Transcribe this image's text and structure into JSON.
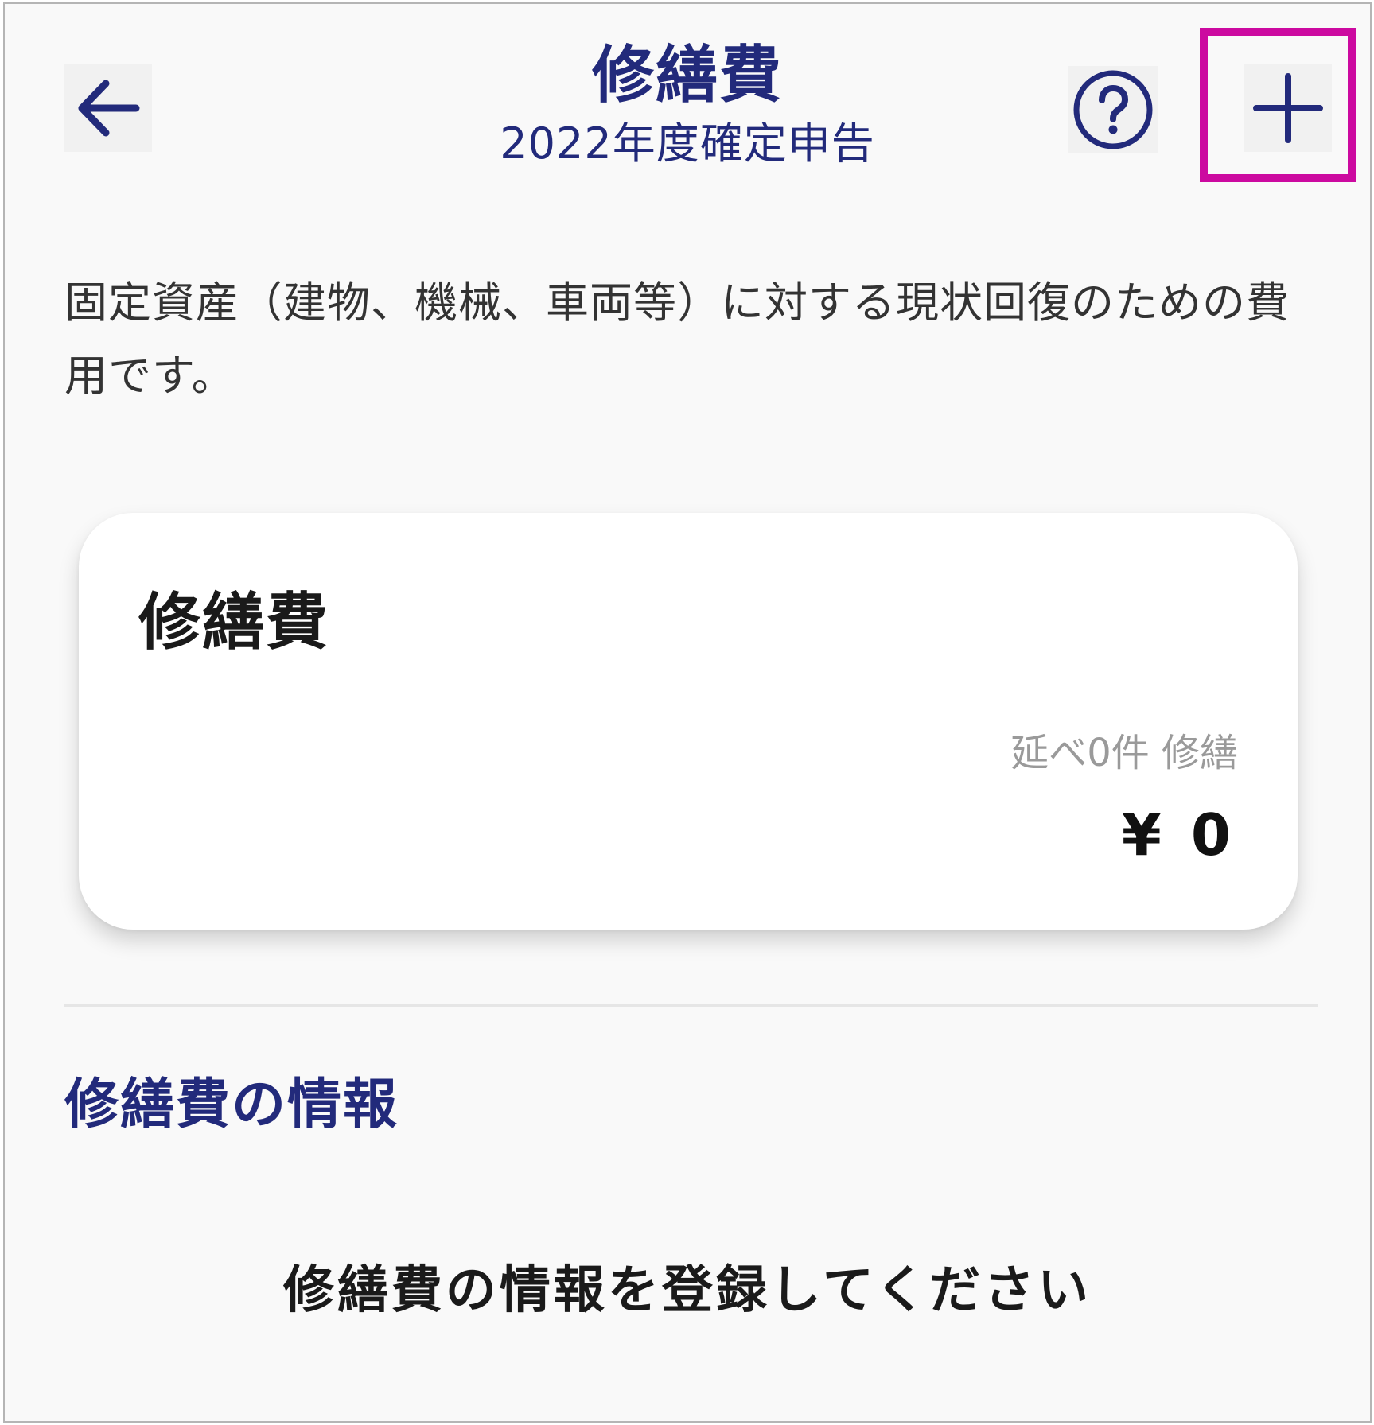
{
  "header": {
    "title": "修繕費",
    "subtitle": "2022年度確定申告",
    "back_icon": "arrow-left-icon",
    "help_icon": "question-circle-icon",
    "add_icon": "plus-icon",
    "accent_color": "#222a7b",
    "highlight_color": "#cc0aa0"
  },
  "description": "固定資産（建物、機械、車両等）に対する現状回復のための費用です。",
  "summary_card": {
    "title": "修繕費",
    "count_text": "延べ0件 修繕",
    "amount": "¥ 0"
  },
  "section": {
    "heading": "修繕費の情報",
    "empty_message": "修繕費の情報を登録してください"
  }
}
